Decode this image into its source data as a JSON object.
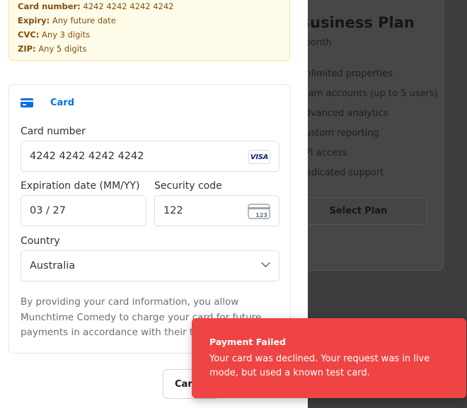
{
  "background": {
    "plan_title": "Business Plan",
    "plan_period": "/month",
    "features": [
      "Unlimited properties",
      "Team accounts (up to 5 users)",
      "Advanced analytics",
      "Custom reporting",
      "API access",
      "Dedicated support"
    ],
    "select_button": "Select Plan"
  },
  "test_card_info": {
    "card_number_label": "Card number:",
    "card_number_value": "4242 4242 4242 4242",
    "expiry_label": "Expiry:",
    "expiry_value": "Any future date",
    "cvc_label": "CVC:",
    "cvc_value": "Any 3 digits",
    "zip_label": "ZIP:",
    "zip_value": "Any 5 digits"
  },
  "payment_form": {
    "tab_label": "Card",
    "card_number_label": "Card number",
    "card_number_value": "4242 4242 4242 4242",
    "card_brand": "VISA",
    "expiry_label": "Expiration date (MM/YY)",
    "expiry_value": "03 / 27",
    "cvc_label": "Security code",
    "cvc_value": "122",
    "cvc_icon_text": "123",
    "country_label": "Country",
    "country_value": "Australia",
    "legal_text": "By providing your card information, you allow Munchtime Comedy to charge your card for future payments in accordance with their terms."
  },
  "actions": {
    "cancel_label": "Cancel"
  },
  "toast": {
    "title": "Payment Failed",
    "message": "Your card was declined. Your request was in live mode, but used a known test card."
  },
  "colors": {
    "accent": "#0570de",
    "toast_bg": "#ef4444",
    "notice_bg": "#fefce8",
    "notice_text": "#854d0e"
  }
}
